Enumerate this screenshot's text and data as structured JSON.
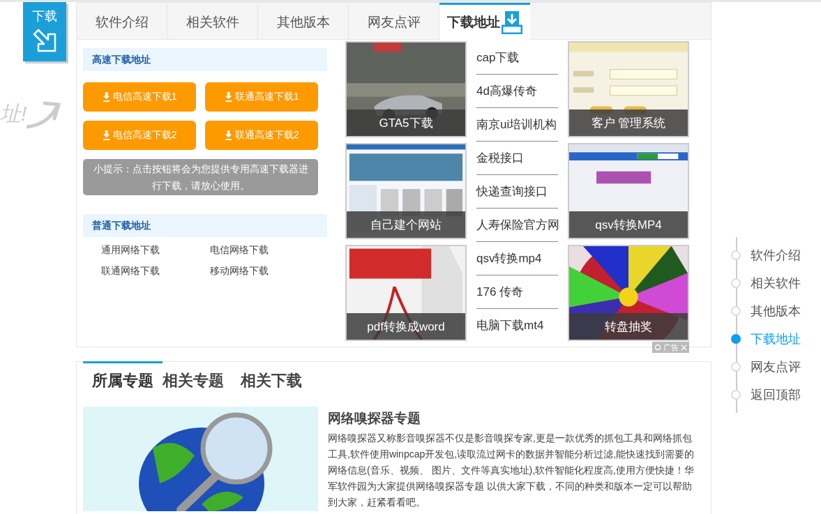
{
  "corner_badge": {
    "label": "下载"
  },
  "side_note": {
    "text": "址!"
  },
  "tabs": [
    {
      "label": "软件介绍",
      "selected": false
    },
    {
      "label": "相关软件",
      "selected": false
    },
    {
      "label": "其他版本",
      "selected": false
    },
    {
      "label": "网友点评",
      "selected": false
    },
    {
      "label": "下载地址",
      "selected": true
    }
  ],
  "fast_download": {
    "title": "高速下载地址",
    "buttons": [
      "电信高速下载1",
      "联通高速下载1",
      "电信高速下载2",
      "联通高速下载2"
    ],
    "tip": "小提示：点击按钮将会为您提供专用高速下载器进行下载，请放心使用。"
  },
  "normal_download": {
    "title": "普通下载地址",
    "links": [
      "通用网络下载",
      "电信网络下载",
      "联通网络下载",
      "移动网络下载"
    ]
  },
  "ads": {
    "left_tiles": [
      {
        "caption": "GTA5下载"
      },
      {
        "caption": "自己建个网站"
      },
      {
        "caption": "pdf转换成word"
      }
    ],
    "links": [
      "cap下载",
      "4d高爆传奇",
      "南京ui培训机构",
      "金税接口",
      "快递查询接口",
      "人寿保险官方网",
      "qsv转换mp4",
      "176 传奇",
      "电脑下载mt4"
    ],
    "right_tiles": [
      {
        "caption": "客户 管理系统"
      },
      {
        "caption": "qsv转换MP4"
      },
      {
        "caption": "转盘抽奖"
      }
    ],
    "badge": "广告"
  },
  "side_nav": [
    {
      "label": "软件介绍",
      "selected": false
    },
    {
      "label": "相关软件",
      "selected": false
    },
    {
      "label": "其他版本",
      "selected": false
    },
    {
      "label": "下载地址",
      "selected": true
    },
    {
      "label": "网友点评",
      "selected": false
    },
    {
      "label": "返回顶部",
      "selected": false
    }
  ],
  "topic_tabs": [
    {
      "label": "所属专题",
      "selected": true
    },
    {
      "label": "相关专题",
      "selected": false
    },
    {
      "label": "相关下载",
      "selected": false
    }
  ],
  "topic": {
    "title": "网络嗅探器专题",
    "description": "网络嗅探器又称影音嗅探器不仅是影音嗅探专家,更是一款优秀的抓包工具和网络抓包工具,软件使用winpcap开发包,读取流过网卡的数据并智能分析过滤,能快速找到需要的网络信息(音乐、视频、 图片、文件等真实地址),软件智能化程度高,使用方便快捷！华军软件园为大家提供网络嗅探器专题 以供大家下载，不同的种类和版本一定可以帮助到大家，赶紧看看吧。"
  }
}
